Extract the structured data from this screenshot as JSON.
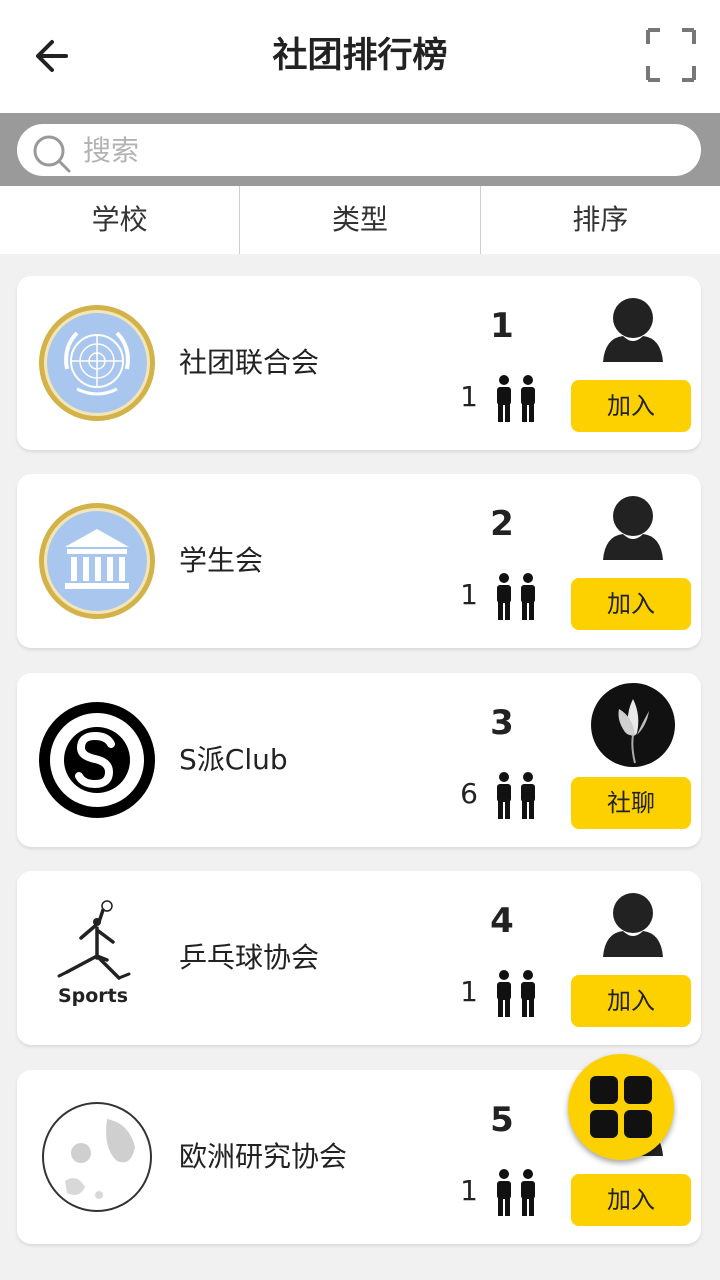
{
  "header": {
    "title": "社团排行榜",
    "back_icon": "arrow-left-icon",
    "scan_icon": "scan-frame-icon"
  },
  "search": {
    "placeholder": "搜索",
    "value": "",
    "icon": "search-icon"
  },
  "filters": [
    "学校",
    "类型",
    "排序"
  ],
  "clubs": [
    {
      "rank": "1",
      "name": "社团联合会",
      "members": "1",
      "logo": "un-emblem-logo",
      "avatar": "default-person-avatar",
      "action": "加入"
    },
    {
      "rank": "2",
      "name": "学生会",
      "members": "1",
      "logo": "building-logo",
      "avatar": "default-person-avatar",
      "action": "加入"
    },
    {
      "rank": "3",
      "name": "S派Club",
      "members": "6",
      "logo": "s-circle-logo",
      "avatar": "flower-avatar",
      "action": "社聊"
    },
    {
      "rank": "4",
      "name": "乒乓球协会",
      "members": "1",
      "logo": "jumpman-logo",
      "logo_text": "Sports",
      "avatar": "default-person-avatar",
      "action": "加入"
    },
    {
      "rank": "5",
      "name": "欧洲研究协会",
      "members": "1",
      "logo": "moon-logo",
      "avatar": "default-person-avatar",
      "action": "加入"
    }
  ],
  "colors": {
    "accent": "#fdd100",
    "search_bar_bg": "#9a9a9a",
    "page_bg": "#f1f1f1",
    "logo_blue": "#a9c7ee",
    "logo_gold": "#d4b24a"
  },
  "fab": {
    "icon": "grid-menu-icon"
  }
}
